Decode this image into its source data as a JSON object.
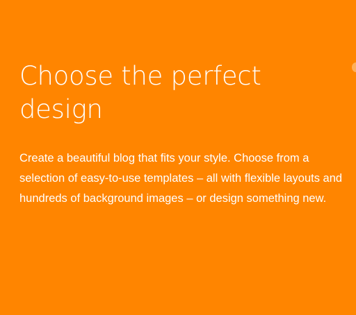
{
  "hero": {
    "headline": "Choose the perfect design",
    "description": "Create a beautiful blog that fits your style. Choose from a selection of easy-to-use templates – all with flexible layouts and hundreds of background images – or design something new."
  },
  "colors": {
    "background": "#FF8500",
    "text": "#FFFFFF"
  }
}
